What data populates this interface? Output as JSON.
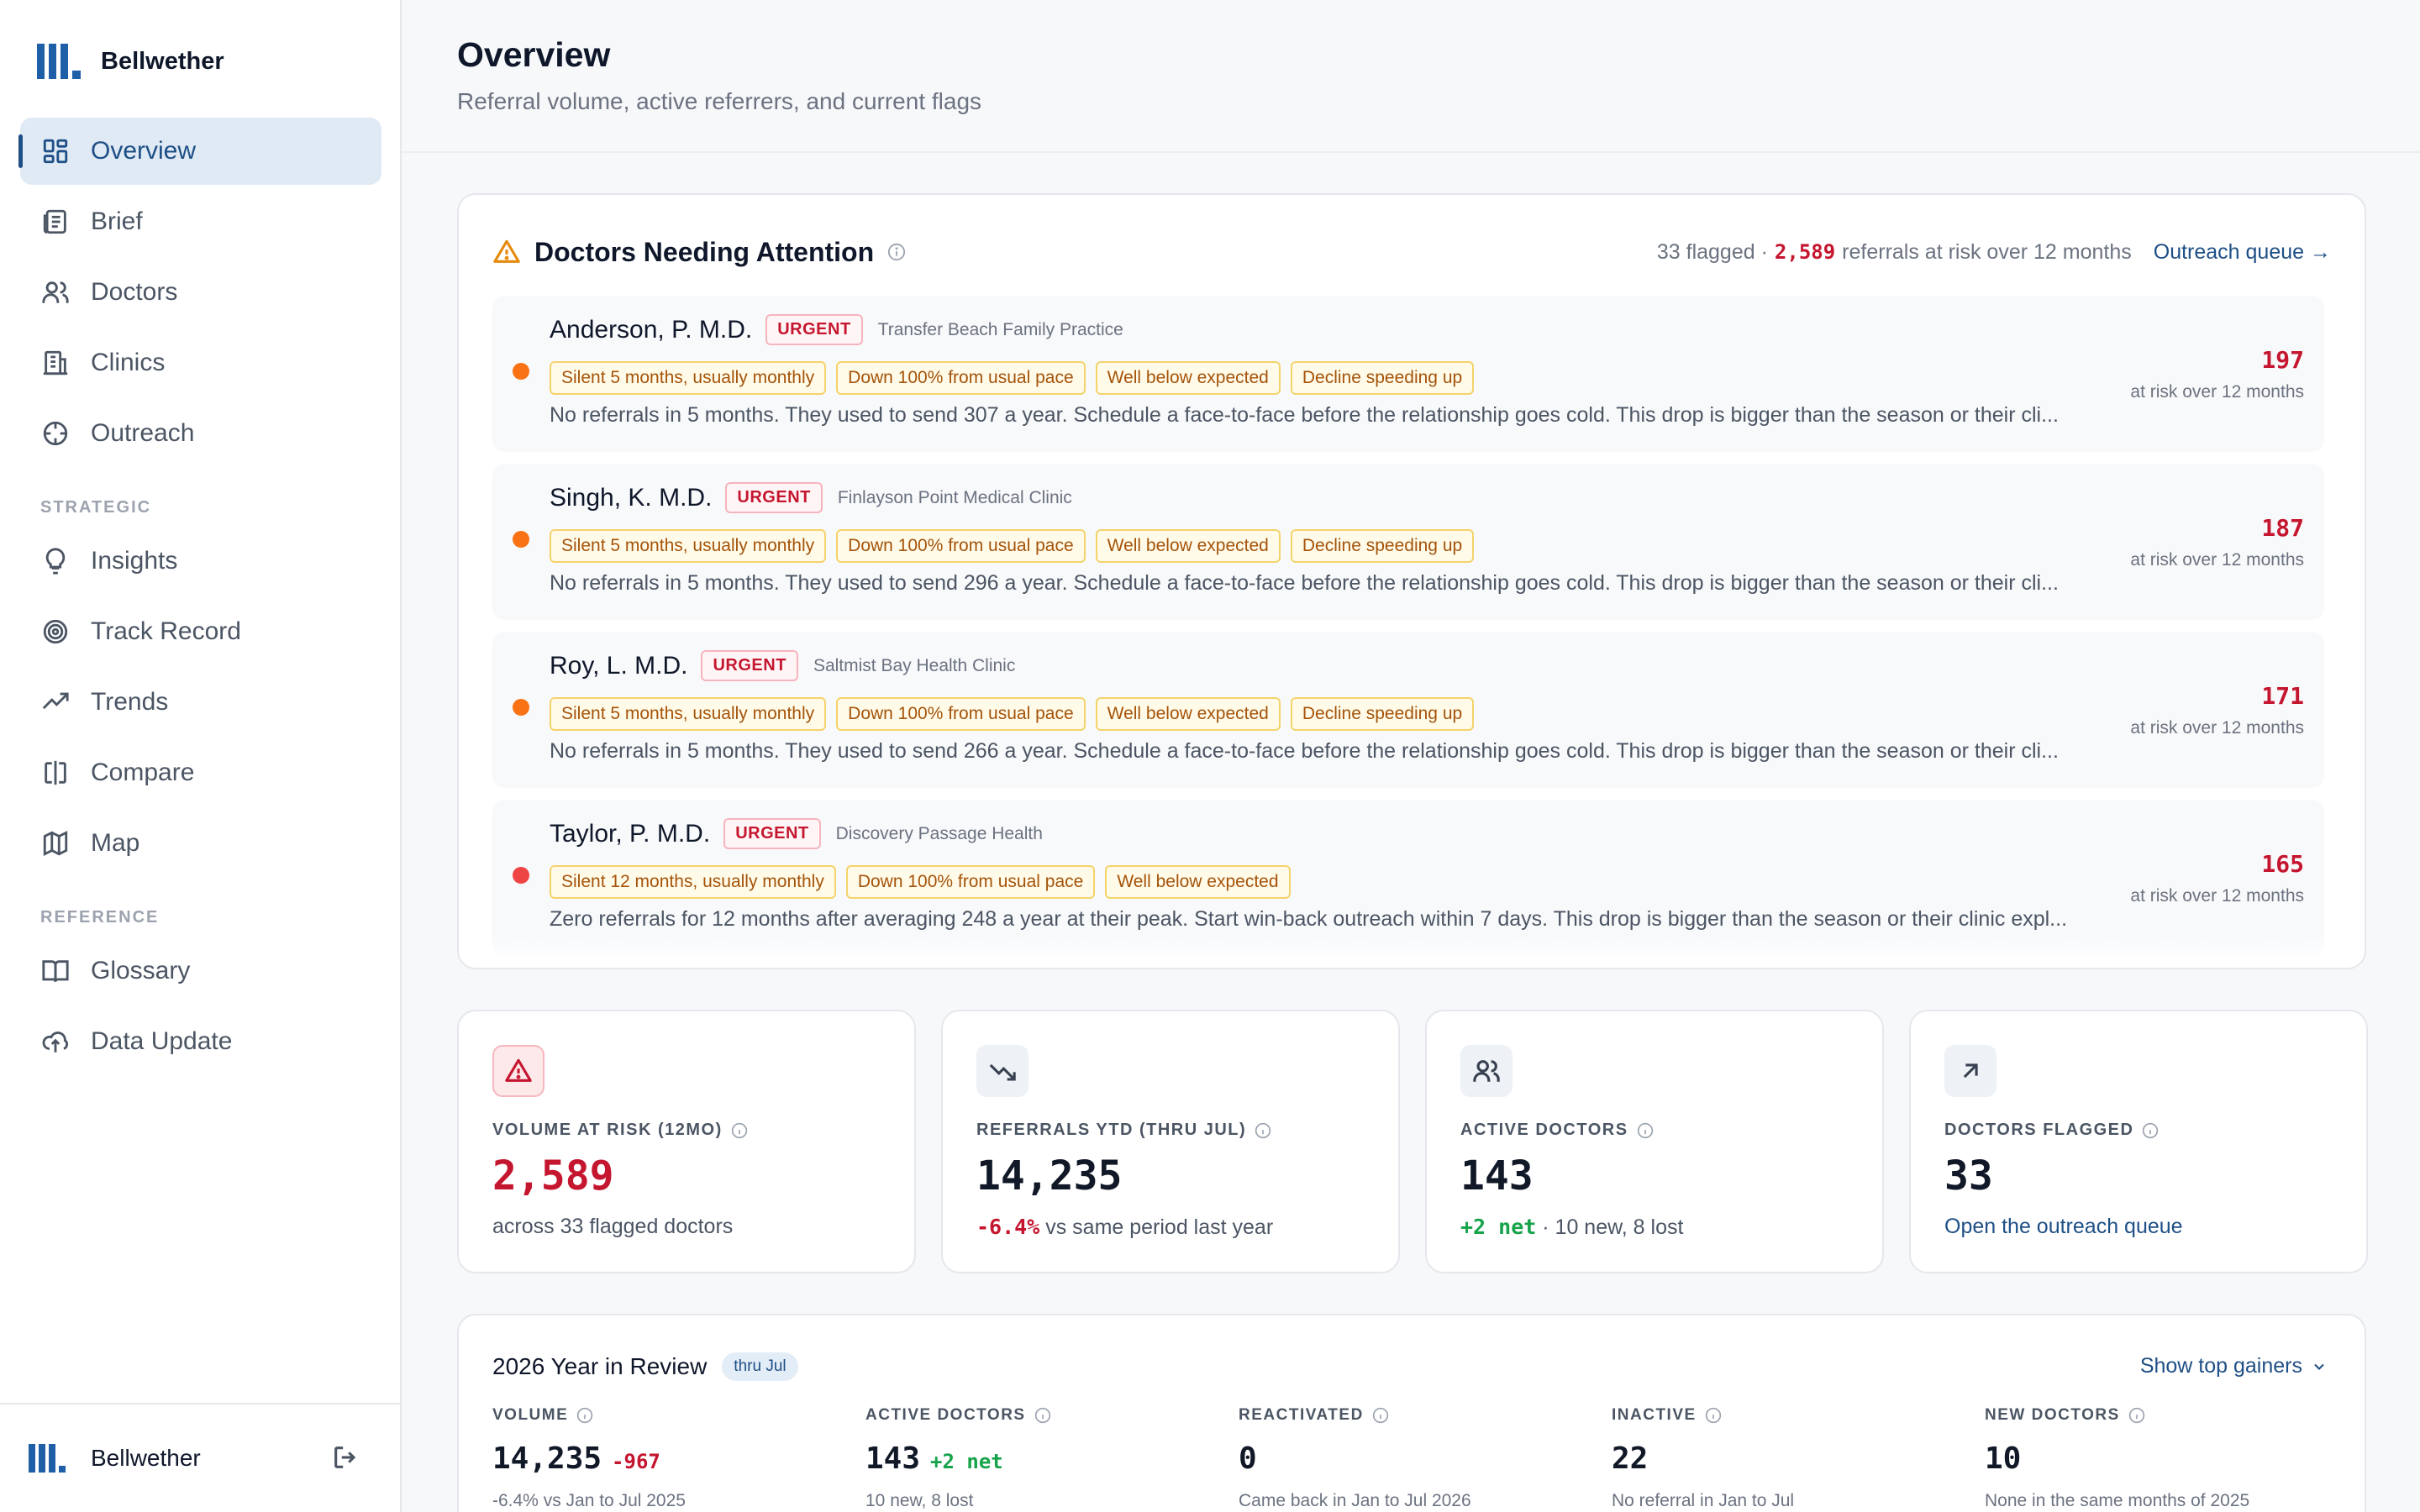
{
  "app": {
    "name": "Bellwether"
  },
  "sidebar": {
    "items": [
      {
        "label": "Overview",
        "icon": "dashboard-icon",
        "active": true
      },
      {
        "label": "Brief",
        "icon": "newspaper-icon"
      },
      {
        "label": "Doctors",
        "icon": "users-icon"
      },
      {
        "label": "Clinics",
        "icon": "building-icon"
      },
      {
        "label": "Outreach",
        "icon": "crosshair-icon"
      }
    ],
    "section_strategic": "STRATEGIC",
    "strategic_items": [
      {
        "label": "Insights",
        "icon": "lightbulb-icon"
      },
      {
        "label": "Track Record",
        "icon": "target-icon"
      },
      {
        "label": "Trends",
        "icon": "trending-up-icon"
      },
      {
        "label": "Compare",
        "icon": "compare-icon"
      },
      {
        "label": "Map",
        "icon": "map-icon"
      }
    ],
    "section_reference": "REFERENCE",
    "reference_items": [
      {
        "label": "Glossary",
        "icon": "book-icon"
      },
      {
        "label": "Data Update",
        "icon": "cloud-upload-icon"
      }
    ],
    "footer_name": "Bellwether"
  },
  "header": {
    "title": "Overview",
    "subtitle": "Referral volume, active referrers, and current flags"
  },
  "attention": {
    "title": "Doctors Needing Attention",
    "flagged_text": "33 flagged ·",
    "risk_value": "2,589",
    "risk_text": "referrals at risk over 12 months",
    "queue_link": "Outreach queue →",
    "rows": [
      {
        "name": "Anderson, P. M.D.",
        "badge": "URGENT",
        "clinic": "Transfer Beach Family Practice",
        "tags": [
          "Silent 5 months, usually monthly",
          "Down 100% from usual pace",
          "Well below expected",
          "Decline speeding up"
        ],
        "desc": "No referrals in 5 months. They used to send 307 a year. Schedule a face-to-face before the relationship goes cold. This drop is bigger than the season or their cli...",
        "risk": "197",
        "risk_caption": "at risk over 12 months",
        "dot_color": "#f97316"
      },
      {
        "name": "Singh, K. M.D.",
        "badge": "URGENT",
        "clinic": "Finlayson Point Medical Clinic",
        "tags": [
          "Silent 5 months, usually monthly",
          "Down 100% from usual pace",
          "Well below expected",
          "Decline speeding up"
        ],
        "desc": "No referrals in 5 months. They used to send 296 a year. Schedule a face-to-face before the relationship goes cold. This drop is bigger than the season or their cli...",
        "risk": "187",
        "risk_caption": "at risk over 12 months",
        "dot_color": "#f97316"
      },
      {
        "name": "Roy, L. M.D.",
        "badge": "URGENT",
        "clinic": "Saltmist Bay Health Clinic",
        "tags": [
          "Silent 5 months, usually monthly",
          "Down 100% from usual pace",
          "Well below expected",
          "Decline speeding up"
        ],
        "desc": "No referrals in 5 months. They used to send 266 a year. Schedule a face-to-face before the relationship goes cold. This drop is bigger than the season or their cli...",
        "risk": "171",
        "risk_caption": "at risk over 12 months",
        "dot_color": "#f97316"
      },
      {
        "name": "Taylor, P. M.D.",
        "badge": "URGENT",
        "clinic": "Discovery Passage Health",
        "tags": [
          "Silent 12 months, usually monthly",
          "Down 100% from usual pace",
          "Well below expected"
        ],
        "desc": "Zero referrals for 12 months after averaging 248 a year at their peak. Start win-back outreach within 7 days. This drop is bigger than the season or their clinic expl...",
        "risk": "165",
        "risk_caption": "at risk over 12 months",
        "dot_color": "#ef4444"
      }
    ]
  },
  "stats": [
    {
      "label": "VOLUME AT RISK (12MO)",
      "value": "2,589",
      "sub_a": "",
      "sub_b": "across 33 flagged doctors",
      "icon": "alert-triangle-icon",
      "value_color": "#c5162f"
    },
    {
      "label": "REFERRALS YTD (THRU JUL)",
      "value": "14,235",
      "sub_a": "-6.4%",
      "sub_b": "vs same period last year",
      "icon": "trending-down-icon",
      "value_color": "#111827"
    },
    {
      "label": "ACTIVE DOCTORS",
      "value": "143",
      "sub_a": "+2 net",
      "sub_b": "· 10 new, 8 lost",
      "icon": "users-icon",
      "value_color": "#111827"
    },
    {
      "label": "DOCTORS FLAGGED",
      "value": "33",
      "link": "Open the outreach queue",
      "icon": "arrow-up-right-icon",
      "value_color": "#111827"
    }
  ],
  "review": {
    "title": "2026 Year in Review",
    "pill": "thru Jul",
    "toggle": "Show top gainers",
    "cols": [
      {
        "label": "VOLUME",
        "value": "14,235",
        "delta": "-967",
        "delta_kind": "neg",
        "sub": "-6.4% vs Jan to Jul 2025"
      },
      {
        "label": "ACTIVE DOCTORS",
        "value": "143",
        "delta": "+2 net",
        "delta_kind": "pos",
        "sub": "10 new, 8 lost"
      },
      {
        "label": "REACTIVATED",
        "value": "0",
        "delta": "",
        "delta_kind": "",
        "sub": "Came back in Jan to Jul 2026"
      },
      {
        "label": "INACTIVE",
        "value": "22",
        "delta": "",
        "delta_kind": "",
        "sub": "No referral in Jan to Jul"
      },
      {
        "label": "NEW DOCTORS",
        "value": "10",
        "delta": "",
        "delta_kind": "",
        "sub": "None in the same months of 2025"
      }
    ]
  },
  "colors": {
    "accent": "#1e4f86",
    "danger": "#c5162f",
    "positive": "#16a34a",
    "warning_tag": "#a5530a"
  }
}
